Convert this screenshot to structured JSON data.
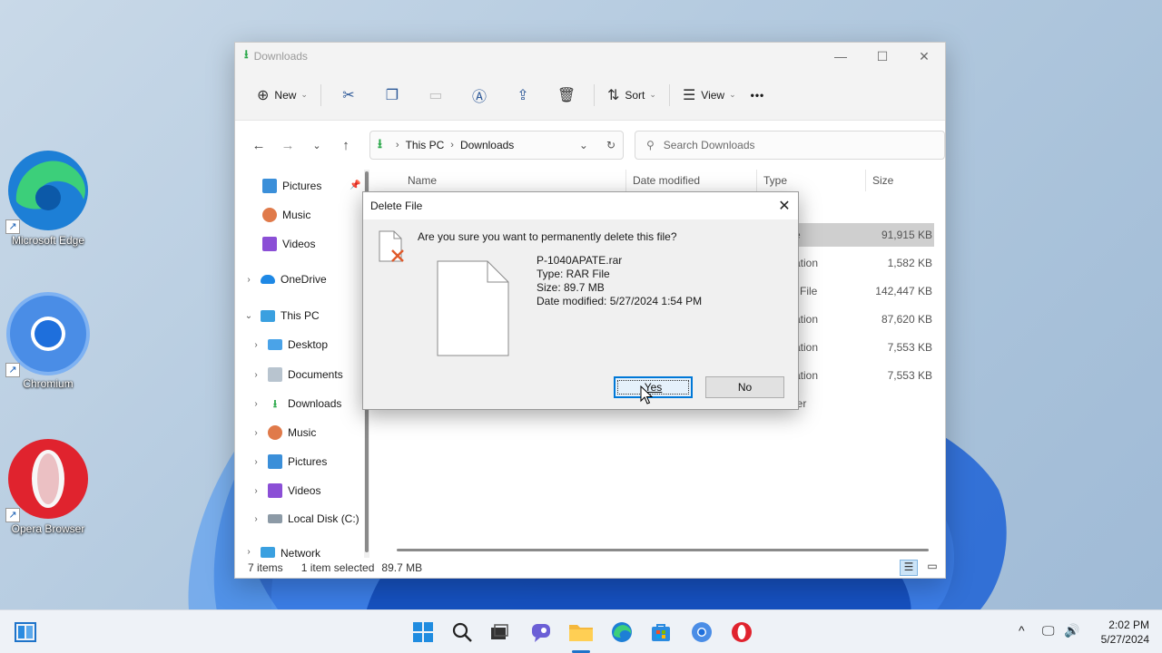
{
  "desktop": {
    "icons": [
      {
        "label": "Microsoft Edge",
        "shortcut_glyph": "↗"
      },
      {
        "label": "Chromium",
        "shortcut_glyph": "↗"
      },
      {
        "label": "Opera Browser",
        "shortcut_glyph": "↗"
      }
    ]
  },
  "explorer": {
    "title": "Downloads",
    "window_controls": {
      "minimize": "—",
      "maximize": "☐",
      "close": "✕"
    },
    "toolbar": {
      "new_label": "New",
      "sort_label": "Sort",
      "view_label": "View",
      "more_label": "•••",
      "icons": [
        "cut-icon",
        "copy-icon",
        "paste-icon",
        "rename-icon",
        "share-icon",
        "delete-icon"
      ]
    },
    "address": {
      "crumbs": [
        "This PC",
        "Downloads"
      ],
      "separator": "›"
    },
    "search": {
      "placeholder": "Search Downloads"
    },
    "nav_pane": {
      "quick_access": [
        {
          "label": "Pictures",
          "icon": "pictures-icon",
          "pinned": true
        },
        {
          "label": "Music",
          "icon": "music-icon"
        },
        {
          "label": "Videos",
          "icon": "videos-icon"
        }
      ],
      "onedrive": "OneDrive",
      "this_pc": "This PC",
      "this_pc_children": [
        {
          "label": "Desktop",
          "icon": "desktop-icon"
        },
        {
          "label": "Documents",
          "icon": "documents-icon"
        },
        {
          "label": "Downloads",
          "icon": "downloads-icon"
        },
        {
          "label": "Music",
          "icon": "music-icon"
        },
        {
          "label": "Pictures",
          "icon": "pictures-icon"
        },
        {
          "label": "Videos",
          "icon": "videos-icon"
        },
        {
          "label": "Local Disk (C:)",
          "icon": "disk-icon"
        }
      ],
      "network": "Network"
    },
    "columns": {
      "name": "Name",
      "date": "Date modified",
      "type": "Type",
      "size": "Size"
    },
    "rows": [
      {
        "type_fragment": "e",
        "size": "91,915 KB",
        "selected": true
      },
      {
        "type_fragment": "ation",
        "size": "1,582 KB"
      },
      {
        "type_fragment": "l File",
        "size": "142,447 KB"
      },
      {
        "type_fragment": "ation",
        "size": "87,620 KB"
      },
      {
        "type_fragment": "ation",
        "size": "7,553 KB"
      },
      {
        "type_fragment": "ation",
        "size": "7,553 KB"
      },
      {
        "type_fragment": "ler",
        "size": ""
      }
    ],
    "status": {
      "items": "7 items",
      "selected": "1 item selected",
      "size": "89.7 MB"
    }
  },
  "dialog": {
    "title": "Delete File",
    "close_glyph": "✕",
    "message": "Are you sure you want to permanently delete this file?",
    "file": {
      "name": "P-1040APATE.rar",
      "type": "Type: RAR File",
      "size": "Size: 89.7 MB",
      "modified": "Date modified: 5/27/2024 1:54 PM"
    },
    "yes_label": "Yes",
    "no_label": "No"
  },
  "taskbar": {
    "time": "2:02 PM",
    "date": "5/27/2024",
    "tray_chevron": "^"
  },
  "colors": {
    "accent": "#0078d7",
    "downloads_green": "#2ba84a",
    "delete_x": "#e05a2b",
    "opera_red": "#e0232e"
  }
}
